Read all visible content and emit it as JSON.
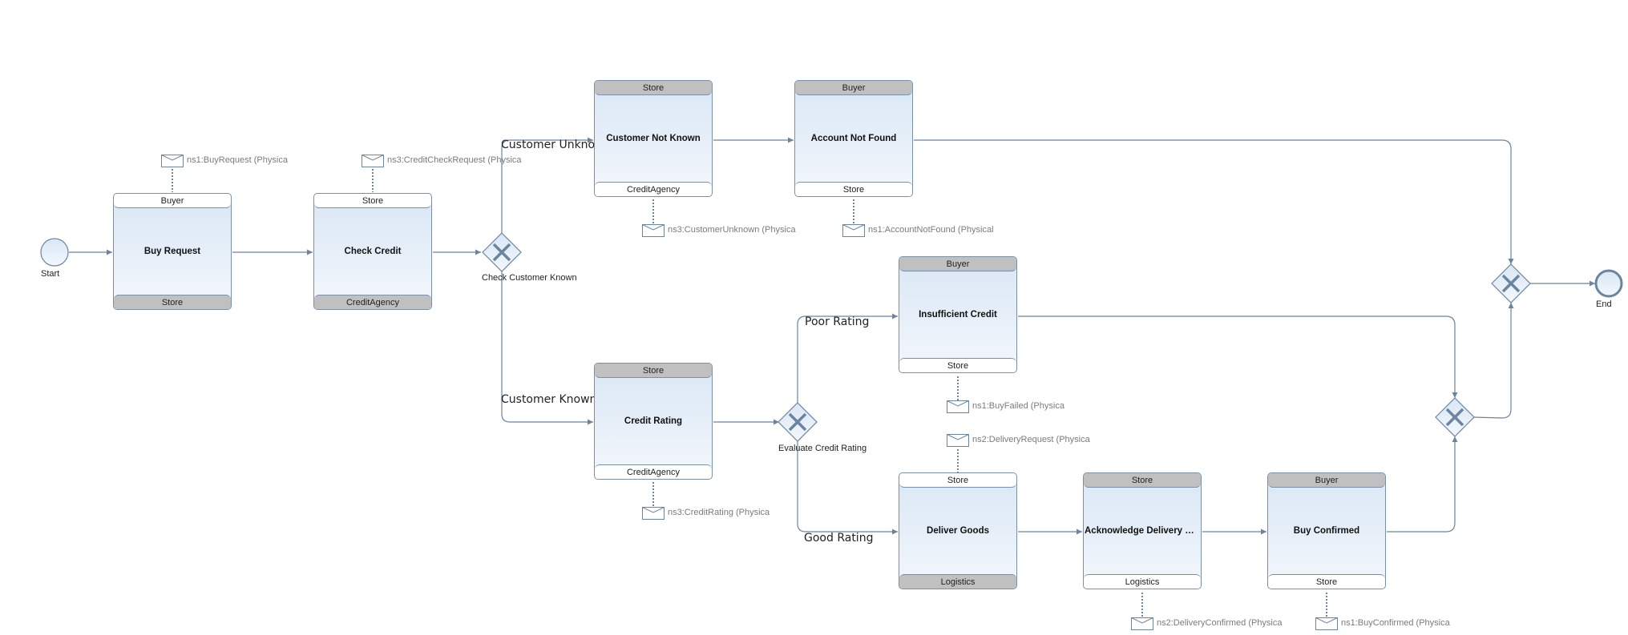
{
  "diagram": {
    "type": "BPMN choreography",
    "colors": {
      "line": "#6b84a0",
      "task_fill_top": "#d9e7f5",
      "task_fill_bottom": "#f3f7fc",
      "receiver_band": "#c0c0c0",
      "message_text": "#7b7b7b"
    },
    "events": {
      "start": {
        "label": "Start",
        "icon": "start-event-circle"
      },
      "end": {
        "label": "End",
        "icon": "end-event-circle"
      }
    },
    "tasks": [
      {
        "id": "buy-request",
        "name": "Buy Request",
        "top": "Buyer",
        "bottom": "Store",
        "top_role": "initiator",
        "message": "ns1:BuyRequest (Physica"
      },
      {
        "id": "check-credit",
        "name": "Check Credit",
        "top": "Store",
        "bottom": "CreditAgency",
        "top_role": "initiator",
        "message": "ns3:CreditCheckRequest (Physica"
      },
      {
        "id": "customer-not-known",
        "name": "Customer Not Known",
        "top": "Store",
        "bottom": "CreditAgency",
        "top_role": "receiver",
        "message": "ns3:CustomerUnknown (Physica"
      },
      {
        "id": "account-not-found",
        "name": "Account Not Found",
        "top": "Buyer",
        "bottom": "Store",
        "top_role": "receiver",
        "message": "ns1:AccountNotFound (Physical"
      },
      {
        "id": "credit-rating",
        "name": "Credit Rating",
        "top": "Store",
        "bottom": "CreditAgency",
        "top_role": "receiver",
        "message": "ns3:CreditRating (Physica"
      },
      {
        "id": "insufficient-credit",
        "name": "Insufficient Credit",
        "top": "Buyer",
        "bottom": "Store",
        "top_role": "receiver",
        "message": "ns1:BuyFailed (Physica"
      },
      {
        "id": "deliver-goods",
        "name": "Deliver Goods",
        "top": "Store",
        "bottom": "Logistics",
        "top_role": "initiator",
        "message": "ns2:DeliveryRequest (Physica"
      },
      {
        "id": "acknowledge-delivery",
        "name": "Acknowledge Delivery Det...",
        "top": "Store",
        "bottom": "Logistics",
        "top_role": "receiver",
        "message": "ns2:DeliveryConfirmed (Physica"
      },
      {
        "id": "buy-confirmed",
        "name": "Buy Confirmed",
        "top": "Buyer",
        "bottom": "Store",
        "top_role": "receiver",
        "message": "ns1:BuyConfirmed (Physica"
      }
    ],
    "gateways": [
      {
        "id": "check-customer-known",
        "label": "Check Customer Known",
        "type": "exclusive"
      },
      {
        "id": "evaluate-credit-rating",
        "label": "Evaluate Credit Rating",
        "type": "exclusive"
      },
      {
        "id": "merge-lower",
        "label": "",
        "type": "exclusive"
      },
      {
        "id": "merge-final",
        "label": "",
        "type": "exclusive"
      }
    ],
    "flow_labels": {
      "customer_unknown": "Customer Unknown",
      "customer_known": "Customer Known",
      "poor_rating": "Poor Rating",
      "good_rating": "Good Rating"
    }
  }
}
